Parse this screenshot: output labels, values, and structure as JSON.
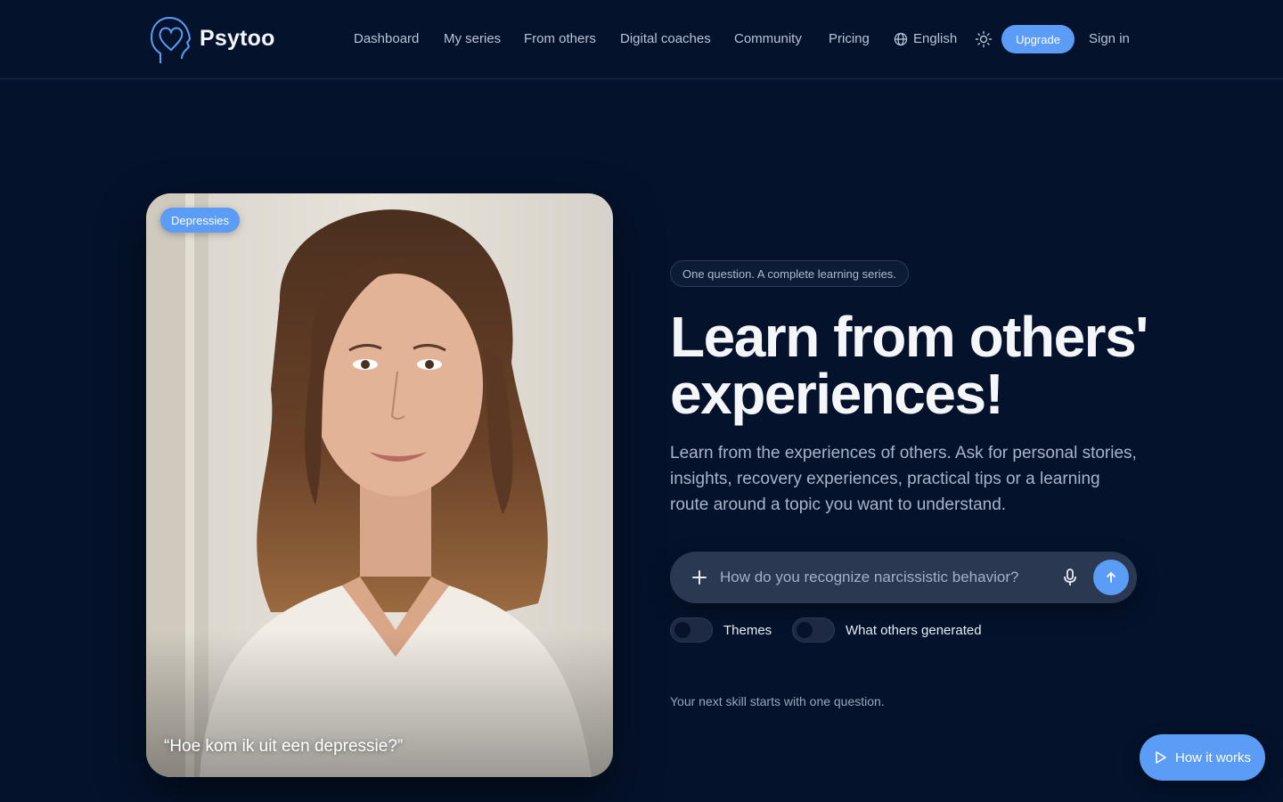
{
  "brand": {
    "name": "Psytoo"
  },
  "nav": {
    "items": [
      "Dashboard",
      "My series",
      "From others",
      "Digital coaches",
      "Community",
      "Pricing"
    ],
    "language": "English",
    "upgrade_label": "Upgrade",
    "signin_label": "Sign in"
  },
  "hero_card": {
    "tag": "Depressies",
    "quote": "“Hoe kom ik uit een depressie?”"
  },
  "hero": {
    "pill": "One question. A complete learning series.",
    "headline_line1": "Learn from others'",
    "headline_line2": "experiences!",
    "subtext": "Learn from the experiences of others. Ask for personal stories, insights, recovery experiences, practical tips or a learning route around a topic you want to understand.",
    "search_placeholder": "How do you recognize narcissistic behavior?",
    "toggles": [
      {
        "label": "Themes",
        "on": false
      },
      {
        "label": "What others generated",
        "on": false
      }
    ],
    "footnote": "Your next skill starts with one question."
  },
  "how_it_works_label": "How it works",
  "colors": {
    "background": "#04122b",
    "accent": "#5b9cf6",
    "input": "#2a3852"
  }
}
